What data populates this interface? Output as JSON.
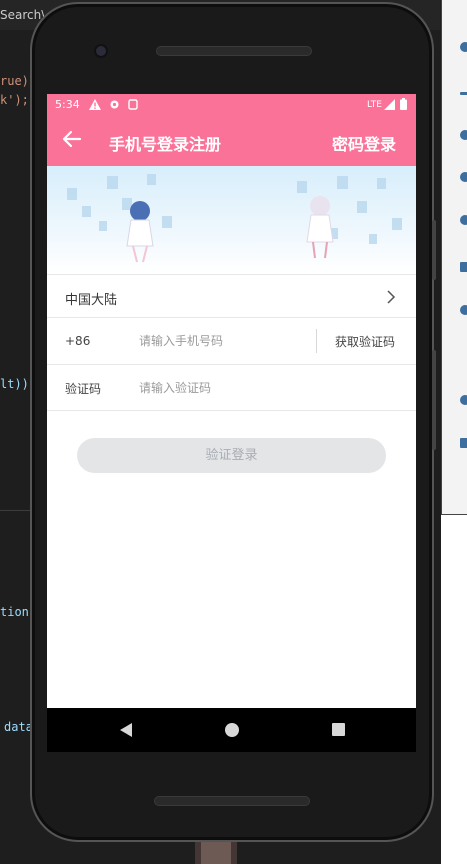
{
  "ide": {
    "search_label": "Search\\",
    "code_lines": [
      "rue)",
      "k');",
      "lt))",
      "tion",
      "data"
    ]
  },
  "statusbar": {
    "time": "5:34",
    "network": "LTE",
    "icons": [
      "warning-icon",
      "settings-icon",
      "sim-icon",
      "signal-icon",
      "battery-icon"
    ]
  },
  "header": {
    "title": "手机号登录注册",
    "right_action": "密码登录",
    "back_icon": "back-arrow-icon"
  },
  "form": {
    "region_label": "中国大陆",
    "phone_prefix": "+86",
    "phone_placeholder": "请输入手机号码",
    "get_code_label": "获取验证码",
    "code_label": "验证码",
    "code_placeholder": "请输入验证码",
    "login_button": "验证登录"
  },
  "colors": {
    "accent": "#fb7299",
    "button_disabled_bg": "#e3e5e7",
    "button_disabled_text": "#a9adb2"
  },
  "navbar": {
    "icons": [
      "nav-back-icon",
      "nav-home-icon",
      "nav-recents-icon"
    ]
  }
}
